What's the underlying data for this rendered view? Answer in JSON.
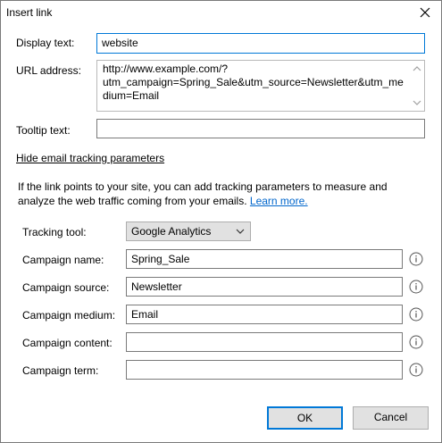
{
  "window": {
    "title": "Insert link"
  },
  "form": {
    "display_text_label": "Display text:",
    "display_text_value": "website",
    "url_label": "URL address:",
    "url_lines": [
      "http://www.example.com/?",
      "utm_campaign=Spring_Sale&utm_source=Newsletter&utm_me",
      "dium=Email"
    ],
    "tooltip_label": "Tooltip text:",
    "tooltip_value": ""
  },
  "tracking": {
    "toggle_link": "Hide email tracking parameters",
    "description": "If the link points to your site, you can add tracking parameters to measure and analyze the web traffic coming from your emails.",
    "learn_more": "Learn more.",
    "tool_label": "Tracking tool:",
    "tool_value": "Google Analytics",
    "fields": [
      {
        "label": "Campaign name:",
        "value": "Spring_Sale"
      },
      {
        "label": "Campaign source:",
        "value": "Newsletter"
      },
      {
        "label": "Campaign medium:",
        "value": "Email"
      },
      {
        "label": "Campaign content:",
        "value": ""
      },
      {
        "label": "Campaign term:",
        "value": ""
      }
    ]
  },
  "buttons": {
    "ok": "OK",
    "cancel": "Cancel"
  },
  "colors": {
    "accent": "#0078d7",
    "link": "#0066cc",
    "button_face": "#e1e1e1"
  }
}
